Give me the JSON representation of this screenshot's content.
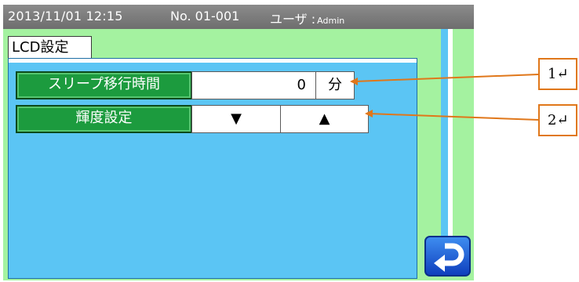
{
  "titlebar": {
    "datetime": "2013/11/01  12:15",
    "screen_no": "No. 01-001",
    "user_label": "ユーザ :",
    "user_name": "Admin"
  },
  "tab": {
    "label": "LCD設定"
  },
  "settings": {
    "sleep": {
      "label": "スリープ移行時間",
      "value": "0",
      "unit": "分"
    },
    "brightness": {
      "label": "輝度設定",
      "down": "▼",
      "up": "▲"
    }
  },
  "callouts": [
    "1↵",
    "2↵"
  ],
  "colors": {
    "screen_bg": "#a4f2a0",
    "panel_bg": "#5bc5f4",
    "label_green": "#1c9b3e",
    "titlebar": "#7a7a7a",
    "callout_orange": "#e0771a",
    "return_button": "#1f5ad8"
  },
  "icons": {
    "return": "return-arrow-icon"
  }
}
